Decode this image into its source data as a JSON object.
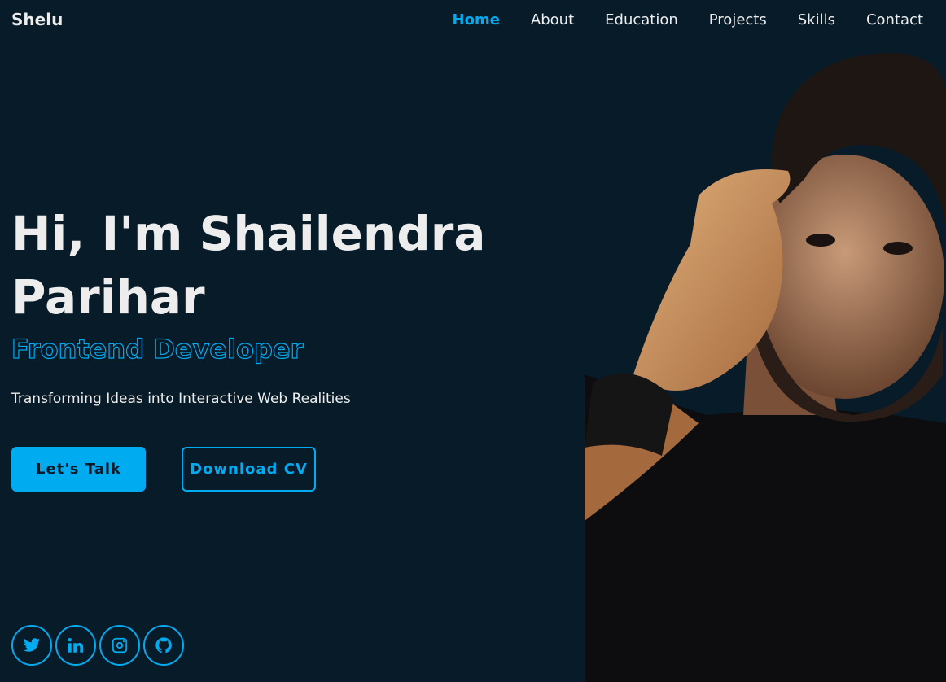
{
  "header": {
    "logo": "Shelu",
    "nav": [
      {
        "label": "Home",
        "active": true
      },
      {
        "label": "About",
        "active": false
      },
      {
        "label": "Education",
        "active": false
      },
      {
        "label": "Projects",
        "active": false
      },
      {
        "label": "Skills",
        "active": false
      },
      {
        "label": "Contact",
        "active": false
      }
    ]
  },
  "hero": {
    "title": "Hi, I'm Shailendra Parihar",
    "role": "Frontend Developer",
    "tagline": "Transforming Ideas into Interactive Web Realities",
    "primary_button": "Let's Talk",
    "secondary_button": "Download CV"
  },
  "socials": [
    {
      "icon": "twitter-icon"
    },
    {
      "icon": "linkedin-icon"
    },
    {
      "icon": "instagram-icon"
    },
    {
      "icon": "github-icon"
    }
  ],
  "colors": {
    "background": "#081b29",
    "accent": "#00abf0",
    "text": "#ededed"
  }
}
